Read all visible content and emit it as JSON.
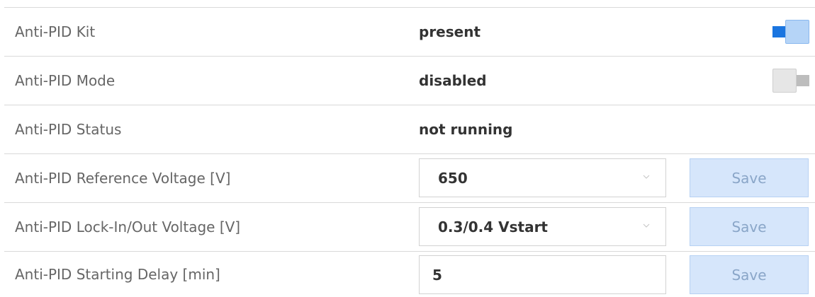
{
  "rows": [
    {
      "label": "Anti-PID Kit",
      "value": "present",
      "toggle": "on"
    },
    {
      "label": "Anti-PID Mode",
      "value": "disabled",
      "toggle": "off"
    },
    {
      "label": "Anti-PID Status",
      "value": "not running"
    },
    {
      "label": "Anti-PID Reference Voltage [V]",
      "value": "650",
      "control": "select",
      "button": "Save"
    },
    {
      "label": "Anti-PID Lock-In/Out Voltage [V]",
      "value": "0.3/0.4 Vstart",
      "control": "select",
      "button": "Save"
    },
    {
      "label": "Anti-PID Starting Delay [min]",
      "value": "5",
      "control": "input",
      "button": "Save"
    }
  ],
  "icons": {
    "select_arrow": "chevron-down-icon"
  },
  "colors": {
    "toggle_on_track": "#1a75e0",
    "toggle_on_knob": "#b5d4f7",
    "toggle_off_track": "#bdbdbd",
    "toggle_off_knob": "#e6e6e6",
    "button_bg": "#d6e6fb",
    "button_text": "#8aa6c8"
  }
}
